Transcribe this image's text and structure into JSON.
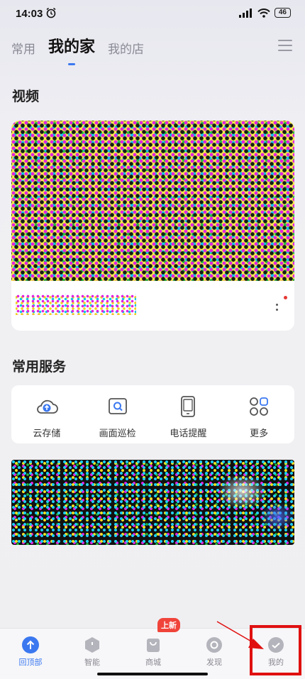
{
  "status_bar": {
    "time": "14:03",
    "battery": "46"
  },
  "tabs": [
    {
      "label": "常用",
      "active": false
    },
    {
      "label": "我的家",
      "active": true
    },
    {
      "label": "我的店",
      "active": false
    }
  ],
  "video_section": {
    "title": "视频"
  },
  "services_section": {
    "title": "常用服务",
    "items": [
      {
        "label": "云存储",
        "icon": "cloud-upload-icon"
      },
      {
        "label": "画面巡检",
        "icon": "screen-search-icon"
      },
      {
        "label": "电话提醒",
        "icon": "phone-icon"
      },
      {
        "label": "更多",
        "icon": "grid-more-icon"
      }
    ]
  },
  "bottom_nav": {
    "badge": "上新",
    "items": [
      {
        "label": "回顶部",
        "icon": "arrow-up-icon",
        "active": true
      },
      {
        "label": "智能",
        "icon": "hexagon-icon",
        "active": false
      },
      {
        "label": "商城",
        "icon": "bag-icon",
        "active": false
      },
      {
        "label": "发现",
        "icon": "compass-icon",
        "active": false
      },
      {
        "label": "我的",
        "icon": "profile-icon",
        "active": false
      }
    ]
  },
  "colors": {
    "accent": "#3b78f0",
    "badge": "#f0443a",
    "annotation": "#e01010"
  }
}
